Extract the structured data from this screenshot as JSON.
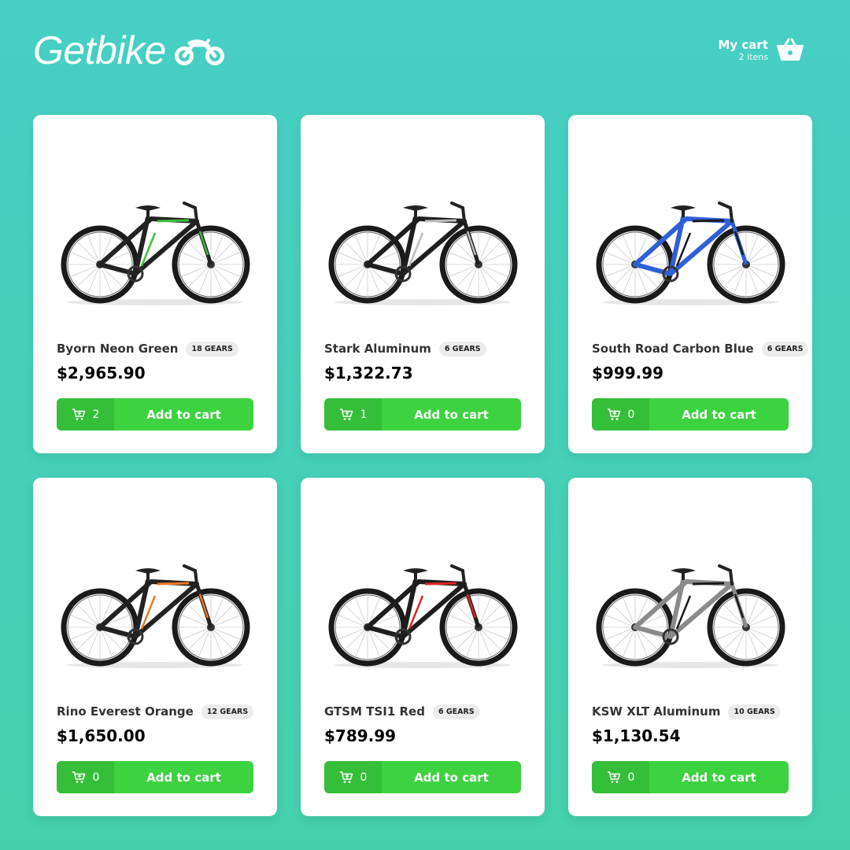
{
  "brand": {
    "name": "Getbike",
    "icon": "motorcycle-icon"
  },
  "cart": {
    "title": "My cart",
    "count_text": "2 itens",
    "icon": "basket-icon"
  },
  "products": [
    {
      "name": "Byorn Neon Green",
      "gears": "18 GEARS",
      "price": "$2,965.90",
      "qty": "2",
      "button": "Add to cart",
      "frame_color": "#222222",
      "accent": "#3fbf3a",
      "wheel": "#1a1a1a"
    },
    {
      "name": "Stark Aluminum",
      "gears": "6 GEARS",
      "price": "$1,322.73",
      "qty": "1",
      "button": "Add to cart",
      "frame_color": "#1e1e1e",
      "accent": "#bdbdbd",
      "wheel": "#1a1a1a"
    },
    {
      "name": "South Road Carbon Blue",
      "gears": "6 GEARS",
      "price": "$999.99",
      "qty": "0",
      "button": "Add to cart",
      "frame_color": "#2f5fd6",
      "accent": "#1a1a1a",
      "wheel": "#1a1a1a"
    },
    {
      "name": "Rino Everest Orange",
      "gears": "12 GEARS",
      "price": "$1,650.00",
      "qty": "0",
      "button": "Add to cart",
      "frame_color": "#222222",
      "accent": "#ef7a22",
      "wheel": "#1a1a1a"
    },
    {
      "name": "GTSM TSI1 Red",
      "gears": "6 GEARS",
      "price": "$789.99",
      "qty": "0",
      "button": "Add to cart",
      "frame_color": "#1e1e1e",
      "accent": "#e02525",
      "wheel": "#1a1a1a"
    },
    {
      "name": "KSW XLT Aluminum",
      "gears": "10 GEARS",
      "price": "$1,130.54",
      "qty": "0",
      "button": "Add to cart",
      "frame_color": "#8a8a8a",
      "accent": "#1a1a1a",
      "wheel": "#1a1a1a"
    }
  ],
  "colors": {
    "background": "#46cfc3",
    "button": "#3dd240",
    "button_dark": "#35be38"
  }
}
